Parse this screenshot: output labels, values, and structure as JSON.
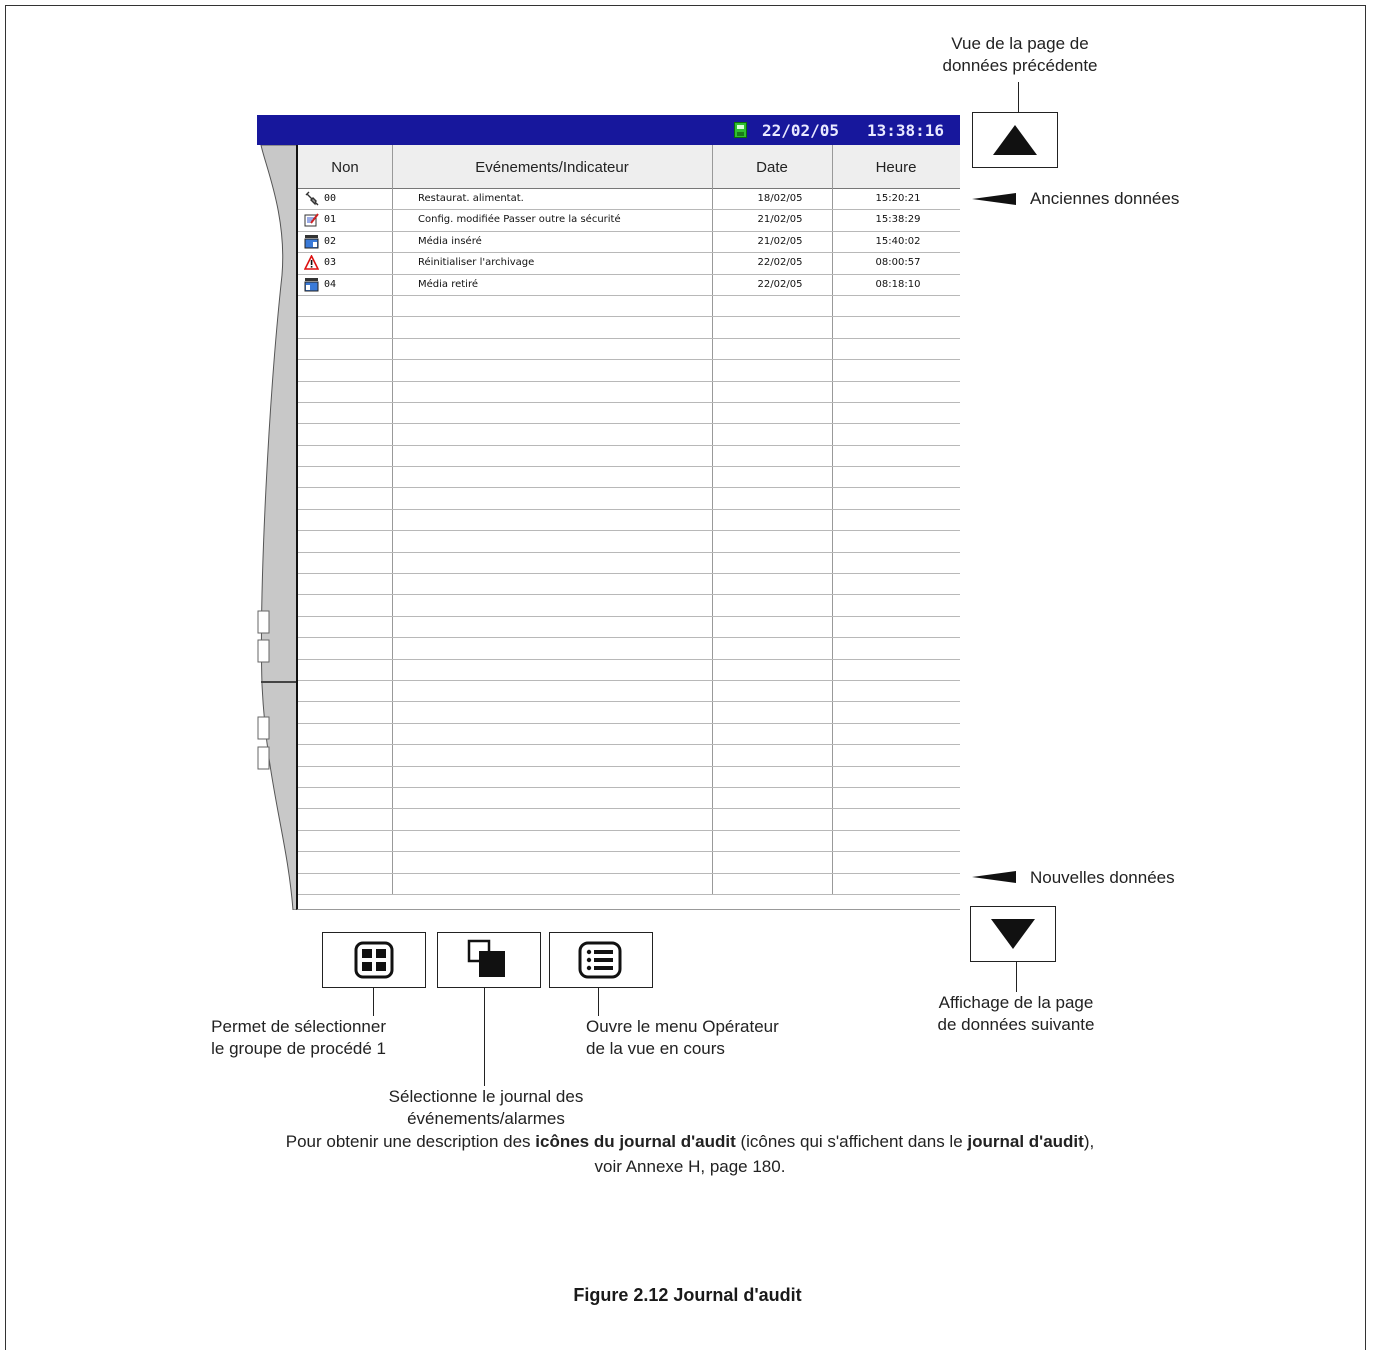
{
  "screen": {
    "date": "22/02/05",
    "time": "13:38:16",
    "columns": [
      "Non",
      "Evénements/Indicateur",
      "Date",
      "Heure"
    ],
    "rows": [
      {
        "icon": "power-restore-icon",
        "no": "00",
        "event": "Restaurat. alimentat.",
        "date": "18/02/05",
        "time": "15:20:21"
      },
      {
        "icon": "config-modified-icon",
        "no": "01",
        "event": "Config. modifiée  Passer outre la sécurité",
        "date": "21/02/05",
        "time": "15:38:29"
      },
      {
        "icon": "media-inserted-icon",
        "no": "02",
        "event": "Média inséré",
        "date": "21/02/05",
        "time": "15:40:02"
      },
      {
        "icon": "warning-icon",
        "no": "03",
        "event": "Réinitialiser l'archivage",
        "date": "22/02/05",
        "time": "08:00:57"
      },
      {
        "icon": "media-removed-icon",
        "no": "04",
        "event": "Média retiré",
        "date": "22/02/05",
        "time": "08:18:10"
      }
    ]
  },
  "callouts": {
    "prev_page": [
      "Vue de la page de",
      "données précédente"
    ],
    "old_data": "Anciennes données",
    "new_data": "Nouvelles données",
    "next_page": [
      "Affichage de la page",
      "de données suivante"
    ],
    "group": [
      "Permet de sélectionner",
      "le groupe de procédé 1"
    ],
    "log": [
      "Sélectionne le journal des",
      "événements/alarmes"
    ],
    "menu": [
      "Ouvre le menu Opérateur",
      "de la vue en cours"
    ]
  },
  "footnote": {
    "part1": "Pour obtenir une description des ",
    "bold1": "icônes du journal d'audit",
    "part2": " (icônes qui s'affichent dans le ",
    "bold2": "journal d'audit",
    "part3": "),",
    "line2": "voir Annexe H, page 180."
  },
  "caption": "Figure 2.12 Journal d'audit",
  "colors": {
    "titlebar": "#17179c",
    "disk": "#30c030"
  }
}
